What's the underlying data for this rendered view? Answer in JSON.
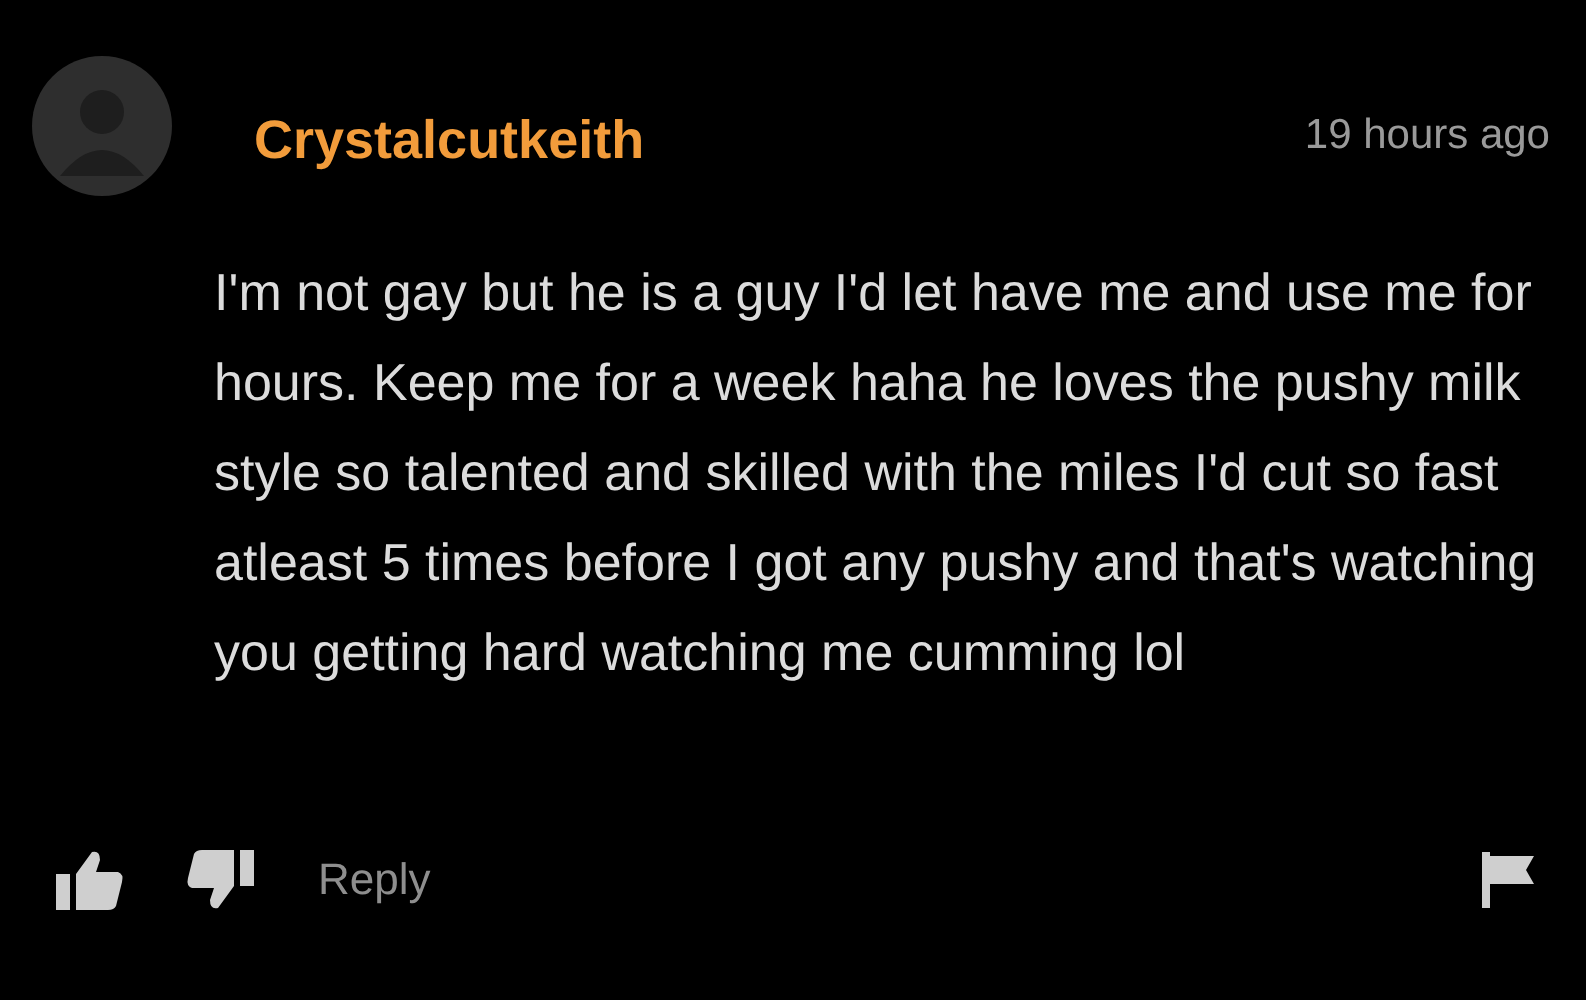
{
  "comment": {
    "username": "Crystalcutkeith",
    "time": "19 hours ago",
    "text": "I'm not gay but he is a guy I'd let have me and use me for hours. Keep me for a week haha he loves the pushy milk style so talented and skilled with the miles I'd cut so fast atleast 5 times before I got any pushy and that's watching you getting hard watching me cumming lol",
    "actions": {
      "reply": "Reply"
    }
  }
}
